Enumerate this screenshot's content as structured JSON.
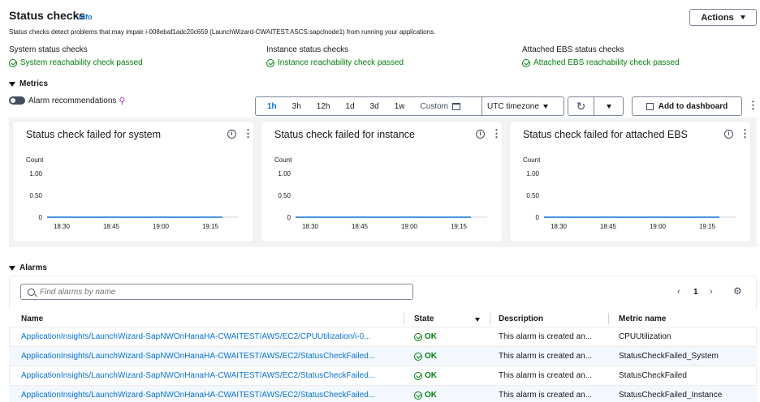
{
  "header": {
    "title": "Status checks",
    "info": "Info",
    "subtitle": "Status checks detect problems that may impair i-008ebaf1adc20c659 (LaunchWizard-CWAITEST:ASCS:sapclnode1) from running your applications.",
    "actions_label": "Actions"
  },
  "checks": [
    {
      "heading": "System status checks",
      "status": "System reachability check passed"
    },
    {
      "heading": "Instance status checks",
      "status": "Instance reachability check passed"
    },
    {
      "heading": "Attached EBS status checks",
      "status": "Attached EBS reachability check passed"
    }
  ],
  "metrics": {
    "section_label": "Metrics",
    "alarm_recommendations": "Alarm recommendations",
    "ranges": [
      "1h",
      "3h",
      "12h",
      "1d",
      "3d",
      "1w"
    ],
    "selected_range": "1h",
    "custom_label": "Custom",
    "timezone": "UTC timezone",
    "add_dashboard": "Add to dashboard"
  },
  "widgets": [
    {
      "title": "Status check failed for system",
      "ylabel": "Count",
      "yticks": [
        "1.00",
        "0.50",
        "0"
      ],
      "xticks": [
        "18:30",
        "18:45",
        "19:00",
        "19:15"
      ]
    },
    {
      "title": "Status check failed for instance",
      "ylabel": "Count",
      "yticks": [
        "1.00",
        "0.50",
        "0"
      ],
      "xticks": [
        "18:30",
        "18:45",
        "19:00",
        "19:15"
      ]
    },
    {
      "title": "Status check failed for attached EBS",
      "ylabel": "Count",
      "yticks": [
        "1.00",
        "0.50",
        "0"
      ],
      "xticks": [
        "18:30",
        "18:45",
        "19:00",
        "19:15"
      ]
    }
  ],
  "chart_data": [
    {
      "type": "line",
      "title": "Status check failed for system",
      "ylabel": "Count",
      "ylim": [
        0,
        1
      ],
      "x": [
        "18:30",
        "18:45",
        "19:00",
        "19:15"
      ],
      "series": [
        {
          "values": [
            0,
            0,
            0,
            0
          ]
        }
      ]
    },
    {
      "type": "line",
      "title": "Status check failed for instance",
      "ylabel": "Count",
      "ylim": [
        0,
        1
      ],
      "x": [
        "18:30",
        "18:45",
        "19:00",
        "19:15"
      ],
      "series": [
        {
          "values": [
            0,
            0,
            0,
            0
          ]
        }
      ]
    },
    {
      "type": "line",
      "title": "Status check failed for attached EBS",
      "ylabel": "Count",
      "ylim": [
        0,
        1
      ],
      "x": [
        "18:30",
        "18:45",
        "19:00",
        "19:15"
      ],
      "series": [
        {
          "values": [
            0,
            0,
            0,
            0
          ]
        }
      ]
    }
  ],
  "alarms": {
    "section_label": "Alarms",
    "search_placeholder": "Find alarms by name",
    "page": "1",
    "columns": [
      "Name",
      "State",
      "Description",
      "Metric name"
    ],
    "rows": [
      {
        "name": "ApplicationInsights/LaunchWizard-SapNWOnHanaHA-CWAITEST/AWS/EC2/CPUUtilization/i-0...",
        "state": "OK",
        "description": "This alarm is created an...",
        "metric": "CPUUtilization"
      },
      {
        "name": "ApplicationInsights/LaunchWizard-SapNWOnHanaHA-CWAITEST/AWS/EC2/StatusCheckFailed...",
        "state": "OK",
        "description": "This alarm is created an...",
        "metric": "StatusCheckFailed_System"
      },
      {
        "name": "ApplicationInsights/LaunchWizard-SapNWOnHanaHA-CWAITEST/AWS/EC2/StatusCheckFailed...",
        "state": "OK",
        "description": "This alarm is created an...",
        "metric": "StatusCheckFailed"
      },
      {
        "name": "ApplicationInsights/LaunchWizard-SapNWOnHanaHA-CWAITEST/AWS/EC2/StatusCheckFailed...",
        "state": "OK",
        "description": "This alarm is created an...",
        "metric": "StatusCheckFailed_Instance"
      }
    ]
  },
  "colors": {
    "link": "#0972d3",
    "ok": "#037f0c",
    "line": "#0972d3"
  }
}
